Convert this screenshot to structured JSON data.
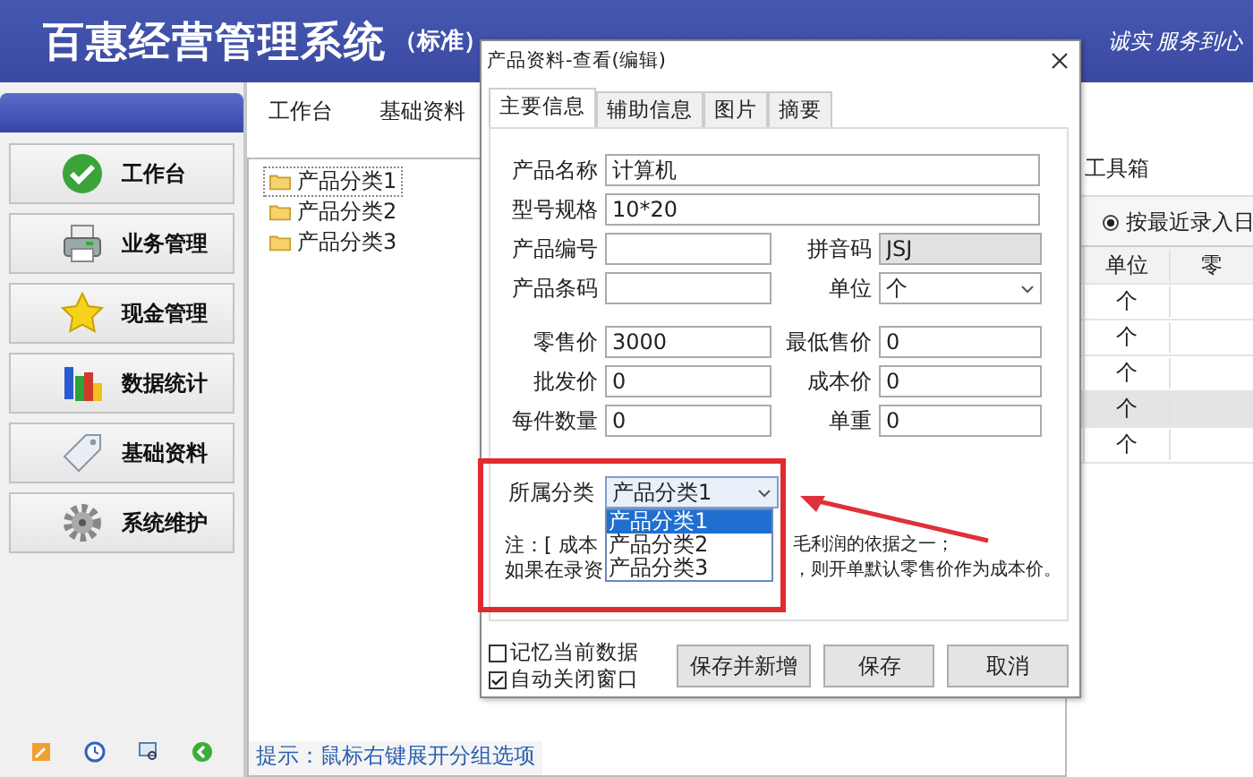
{
  "app": {
    "title": "百惠经营管理系统",
    "edition": "（标准）",
    "slogan": "诚实 服务到心"
  },
  "sidebar": {
    "items": [
      {
        "label": "工作台",
        "kind": "check"
      },
      {
        "label": "业务管理",
        "kind": "printer"
      },
      {
        "label": "现金管理",
        "kind": "star"
      },
      {
        "label": "数据统计",
        "kind": "chart"
      },
      {
        "label": "基础资料",
        "kind": "tag"
      },
      {
        "label": "系统维护",
        "kind": "gear"
      }
    ]
  },
  "main_tabs": [
    "工作台",
    "基础资料"
  ],
  "tree": {
    "items": [
      {
        "label": "产品分类1",
        "selected": true
      },
      {
        "label": "产品分类2",
        "selected": false
      },
      {
        "label": "产品分类3",
        "selected": false
      }
    ]
  },
  "hint": "提示：鼠标右键展开分组选项",
  "list_panel": {
    "title": "工具箱",
    "radio": {
      "label": "按最近录入日",
      "selected": true
    },
    "columns": [
      "单位",
      "零"
    ],
    "rows": [
      {
        "unit": "个",
        "selected": false
      },
      {
        "unit": "个",
        "selected": false
      },
      {
        "unit": "个",
        "selected": false
      },
      {
        "unit": "个",
        "selected": true
      },
      {
        "unit": "个",
        "selected": false
      }
    ]
  },
  "dialog": {
    "title": "产品资料-查看(编辑)",
    "tabs": [
      {
        "label": "主要信息",
        "selected": true
      },
      {
        "label": "辅助信息",
        "selected": false
      },
      {
        "label": "图片",
        "selected": false
      },
      {
        "label": "摘要",
        "selected": false
      }
    ],
    "wide_fields": [
      {
        "label": "产品名称",
        "value": "计算机"
      },
      {
        "label": "型号规格",
        "value": "10*20"
      }
    ],
    "pair_rows": [
      [
        {
          "label": "产品编号",
          "kind": "text"
        },
        {
          "label": "拼音码",
          "value": "JSJ",
          "kind": "readonly"
        }
      ],
      [
        {
          "label": "产品条码",
          "kind": "text"
        },
        {
          "label": "单位",
          "value": "个",
          "kind": "select"
        }
      ]
    ],
    "price_rows": [
      [
        {
          "label": "零售价",
          "value": "3000",
          "kind": "text"
        },
        {
          "label": "最低售价",
          "value": "0",
          "kind": "text"
        }
      ],
      [
        {
          "label": "批发价",
          "value": "0",
          "kind": "text"
        },
        {
          "label": "成本价",
          "value": "0",
          "kind": "text"
        }
      ],
      [
        {
          "label": "每件数量",
          "value": "0",
          "kind": "text"
        },
        {
          "label": "单重",
          "value": "0",
          "kind": "text"
        }
      ]
    ],
    "category": {
      "label": "所属分类",
      "value": "产品分类1",
      "options": [
        {
          "label": "产品分类1",
          "selected": true
        },
        {
          "label": "产品分类2",
          "selected": false
        },
        {
          "label": "产品分类3",
          "selected": false
        }
      ]
    },
    "note_lines": [
      [
        "注：[ 成本",
        "毛利润的依据之一；"
      ],
      [
        "如果在录资",
        "，则开单默认零售价作为成本价。"
      ]
    ],
    "checkboxes": [
      {
        "label": "记忆当前数据",
        "checked": false
      },
      {
        "label": "自动关闭窗口",
        "checked": true
      }
    ],
    "buttons": [
      "保存并新增",
      "保存",
      "取消"
    ]
  }
}
